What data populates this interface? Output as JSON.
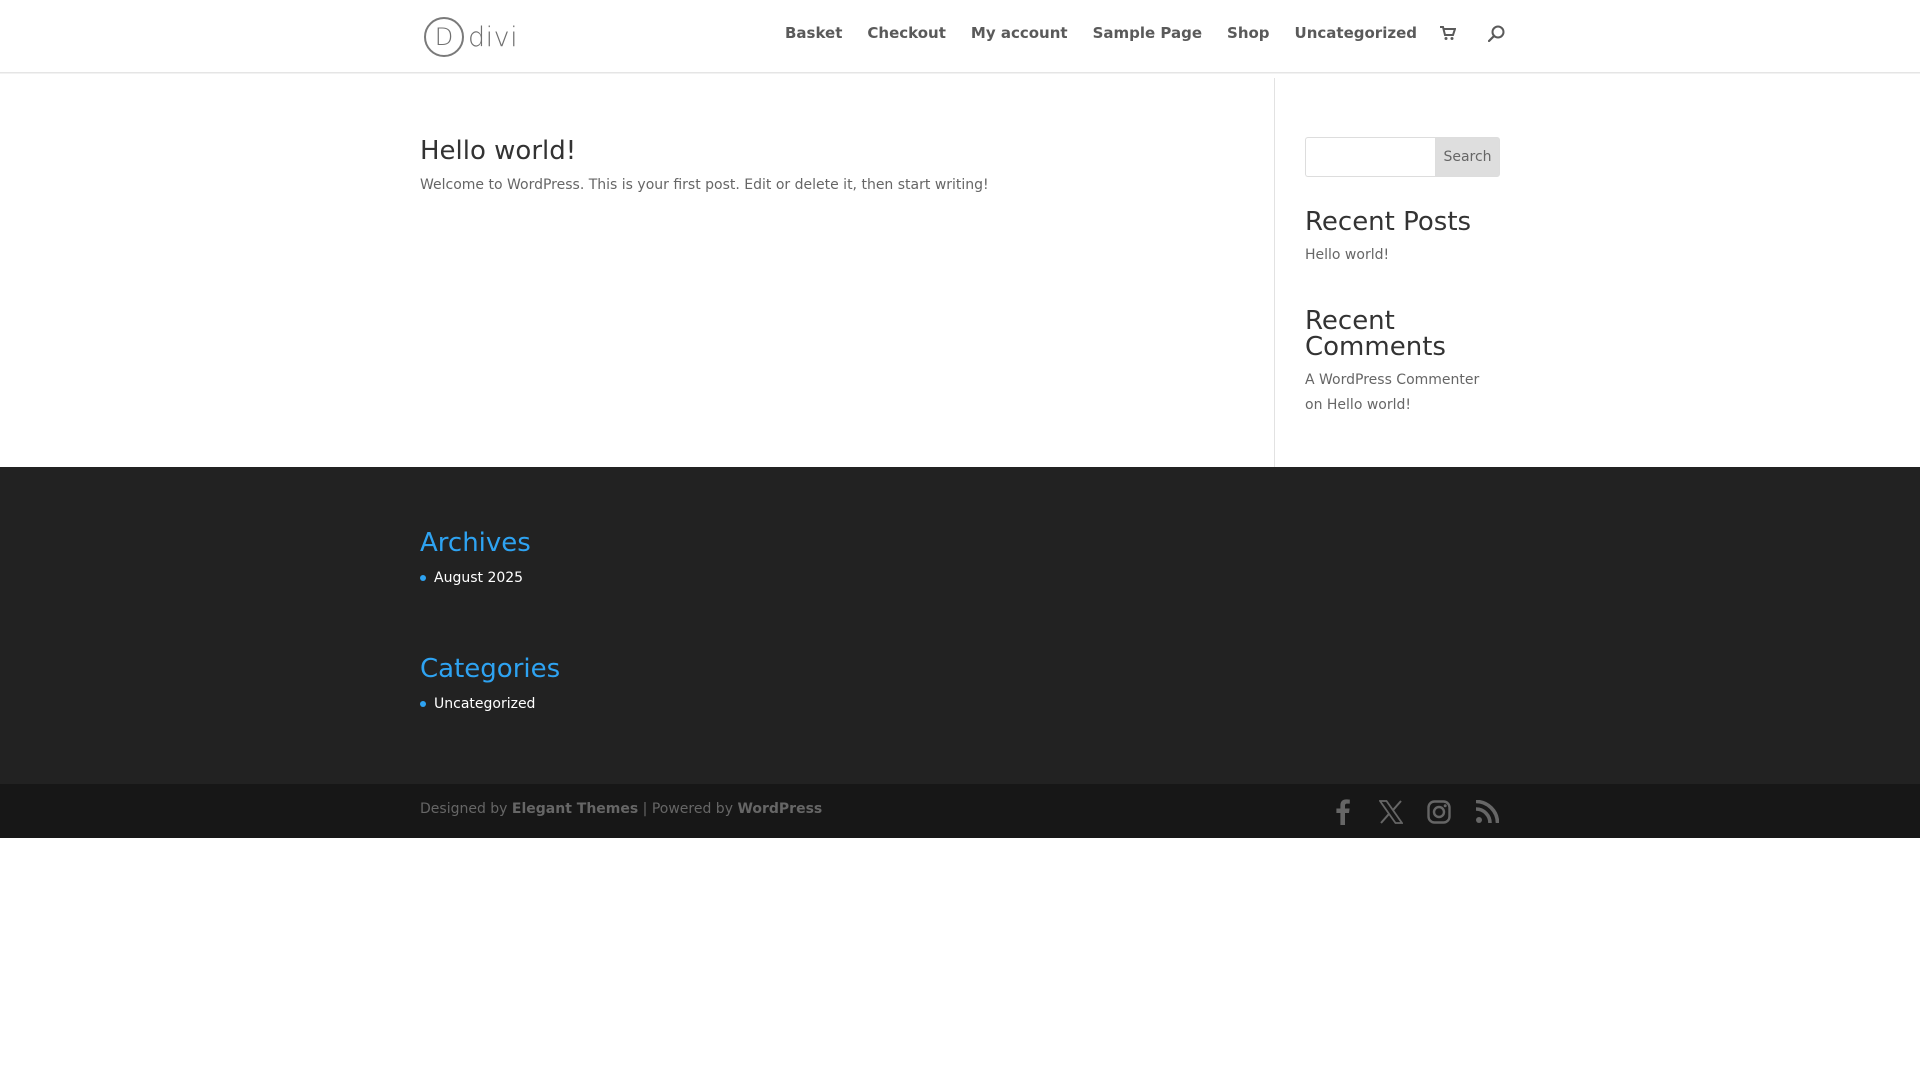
{
  "header": {
    "logo_mark": "D",
    "logo_word": "divi",
    "nav": [
      "Basket",
      "Checkout",
      "My account",
      "Sample Page",
      "Shop",
      "Uncategorized"
    ],
    "icons": [
      "cart-icon",
      "search-icon"
    ]
  },
  "post": {
    "title": "Hello world!",
    "excerpt": "Welcome to WordPress. This is your first post. Edit or delete it, then start writing!"
  },
  "sidebar": {
    "search_placeholder": "",
    "search_button": "Search",
    "recent_posts_title": "Recent Posts",
    "recent_posts": [
      "Hello world!"
    ],
    "recent_comments_title": "Recent Comments",
    "recent_comment": {
      "author": "A WordPress Commenter",
      "on": "on",
      "post": "Hello world!"
    }
  },
  "footer": {
    "archives_title": "Archives",
    "archives": [
      "August 2025"
    ],
    "categories_title": "Categories",
    "categories": [
      "Uncategorized"
    ]
  },
  "bottom": {
    "designed_by": "Designed by",
    "theme_name": "Elegant Themes",
    "separator": "| Powered by",
    "platform": "WordPress",
    "socials": [
      "facebook-icon",
      "x-icon",
      "instagram-icon",
      "rss-icon"
    ]
  },
  "colors": {
    "accent": "#2ea3f2",
    "footer_bg": "#222222",
    "bottom_bg": "#171717"
  }
}
